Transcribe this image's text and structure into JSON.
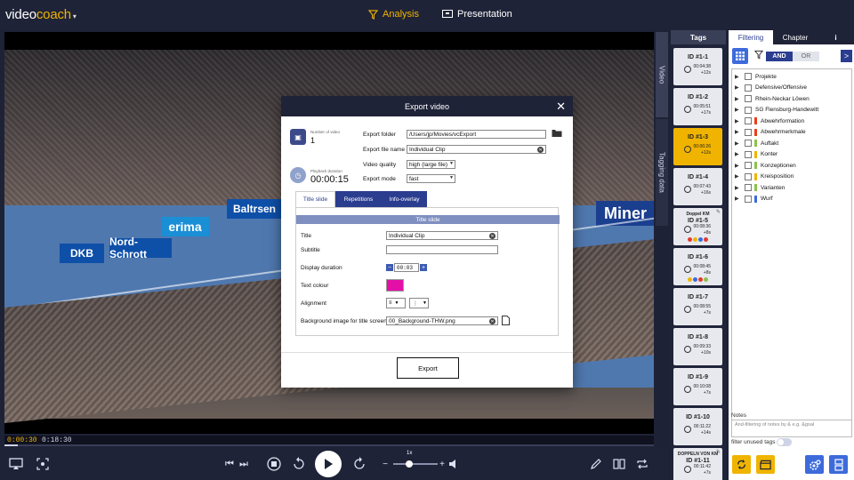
{
  "app": {
    "logo_main": "video",
    "logo_accent": "coach",
    "nav": {
      "analysis": "Analysis",
      "presentation": "Presentation"
    }
  },
  "video": {
    "side_tabs": {
      "video": "Video",
      "tagging": "Tagging data"
    },
    "ads": [
      "DKB",
      "Nord-Schrott",
      "erima",
      "Baltrsen",
      "Miner",
      "DKB"
    ]
  },
  "timeline": {
    "current": "0:00:30",
    "total": "0:18:30",
    "progress": 0.02
  },
  "controls": {
    "speed": "1x"
  },
  "tags": {
    "header": "Tags",
    "items": [
      {
        "title": "ID #1-1",
        "time": "00:04:38",
        "dur": "+12s",
        "active": false,
        "small": false,
        "dots": []
      },
      {
        "title": "ID #1-2",
        "time": "00:05:51",
        "dur": "+17s",
        "active": false,
        "small": false,
        "dots": []
      },
      {
        "title": "ID #1-3",
        "time": "00:06:26",
        "dur": "+12s",
        "active": true,
        "small": false,
        "dots": []
      },
      {
        "title": "ID #1-4",
        "time": "00:07:43",
        "dur": "+16s",
        "active": false,
        "small": false,
        "dots": []
      },
      {
        "title": "Doppel KM",
        "sub": "ID #1-5",
        "time": "00:08:36",
        "dur": "+8s",
        "active": false,
        "small": true,
        "dots": [
          "#e23b2e",
          "#f0b400",
          "#3d6bdb",
          "#e23b2e"
        ]
      },
      {
        "title": "ID #1-6",
        "time": "00:08:45",
        "dur": "+8s",
        "active": false,
        "small": false,
        "dots": [
          "#f0b400",
          "#3d6bdb",
          "#e23b2e",
          "#8bc34a"
        ]
      },
      {
        "title": "ID #1-7",
        "time": "00:08:55",
        "dur": "+7s",
        "active": false,
        "small": false,
        "dots": []
      },
      {
        "title": "ID #1-8",
        "time": "00:09:33",
        "dur": "+10s",
        "active": false,
        "small": false,
        "dots": []
      },
      {
        "title": "ID #1-9",
        "time": "00:10:08",
        "dur": "+7s",
        "active": false,
        "small": false,
        "dots": []
      },
      {
        "title": "ID #1-10",
        "time": "00:11:22",
        "dur": "+14s",
        "active": false,
        "small": false,
        "dots": []
      },
      {
        "title": "DOPPELN VON KM",
        "sub": "ID #1-11",
        "time": "00:11:42",
        "dur": "+7s",
        "active": false,
        "small": true,
        "dots": []
      }
    ]
  },
  "right_panel": {
    "tabs": {
      "filtering": "Filtering",
      "chapter": "Chapter",
      "info": "i"
    },
    "and_label": "AND",
    "or_label": "OR",
    "next_label": ">",
    "filters": [
      {
        "label": "Projekte",
        "color": ""
      },
      {
        "label": "Defensive/Offensive",
        "color": ""
      },
      {
        "label": "Rhein-Neckar Löwen",
        "color": ""
      },
      {
        "label": "SG Flensburg-Handewitt",
        "color": ""
      },
      {
        "label": "Abwehrformation",
        "color": "#e8401c"
      },
      {
        "label": "Abwehrmerkmale",
        "color": "#e8401c"
      },
      {
        "label": "Auftakt",
        "color": "#8bc34a"
      },
      {
        "label": "Konter",
        "color": "#f0b400"
      },
      {
        "label": "Konzeptionen",
        "color": "#8bc34a"
      },
      {
        "label": "Kreisposition",
        "color": "#f0b400"
      },
      {
        "label": "Varianten",
        "color": "#8bc34a"
      },
      {
        "label": "Wurf",
        "color": "#3d6bdb"
      }
    ],
    "notes_label": "Notes",
    "notes_placeholder": "And-filtering of notes by & e.g. &goal",
    "filter_unused": "filter unused tags"
  },
  "export_dialog": {
    "title": "Export video",
    "number_of_video_label": "Number of video",
    "number_of_video": "1",
    "playback_duration_label": "Playback duration",
    "playback_duration": "00:00:15",
    "export_folder_label": "Export folder",
    "export_folder": "/Users/jp/Movies/vcExport",
    "export_file_name_label": "Export file name",
    "export_file_name": "Individual Clip",
    "video_quality_label": "Video quality",
    "video_quality": "high (large file)",
    "export_mode_label": "Export mode",
    "export_mode": "fast",
    "tabs": {
      "title_slide": "Title slide",
      "repetitions": "Repetitions",
      "info_overlay": "Info-overlay"
    },
    "section_title": "Title slide",
    "title_label": "Title",
    "title_value": "Individual Clip",
    "subtitle_label": "Subtitle",
    "subtitle_value": "",
    "display_duration_label": "Display duration",
    "display_duration": "00:03",
    "text_colour_label": "Text colour",
    "text_colour": "#e30fa7",
    "alignment_label": "Alignment",
    "bg_image_label": "Background image for title screen",
    "bg_image": "00_Background-THW.png",
    "export_button": "Export"
  }
}
